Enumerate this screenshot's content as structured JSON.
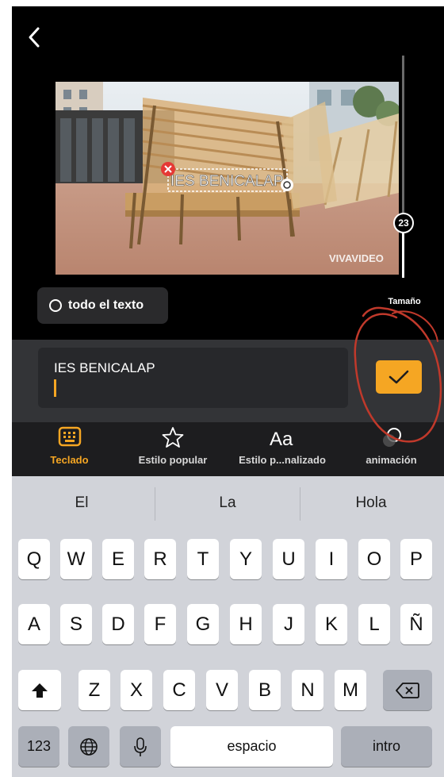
{
  "editor": {
    "watermark": "VIVAVIDEO",
    "caption_overlay": "IES BENICALAP",
    "size_value": "23",
    "size_label": "Tamaño",
    "all_text_label": "todo el texto"
  },
  "input": {
    "value": "IES BENICALAP"
  },
  "tabs": [
    {
      "label": "Teclado",
      "icon": "keyboard-icon",
      "active": true
    },
    {
      "label": "Estilo popular",
      "icon": "star-icon",
      "active": false
    },
    {
      "label": "Estilo p...nalizado",
      "icon": "text-style-icon",
      "active": false
    },
    {
      "label": "animación",
      "icon": "animation-icon",
      "active": false
    }
  ],
  "keyboard": {
    "suggestions": [
      "El",
      "La",
      "Hola"
    ],
    "row1": [
      "Q",
      "W",
      "E",
      "R",
      "T",
      "Y",
      "U",
      "I",
      "O",
      "P"
    ],
    "row2": [
      "A",
      "S",
      "D",
      "F",
      "G",
      "H",
      "J",
      "K",
      "L",
      "Ñ"
    ],
    "row3": [
      "Z",
      "X",
      "C",
      "V",
      "B",
      "N",
      "M"
    ],
    "numbers_key": "123",
    "space_key": "espacio",
    "return_key": "intro"
  },
  "colors": {
    "accent": "#f5a623",
    "panel": "#333437",
    "tab_bar": "#1d1d1f",
    "keyboard_bg": "#d1d3d9",
    "annotation": "#c0392b"
  }
}
